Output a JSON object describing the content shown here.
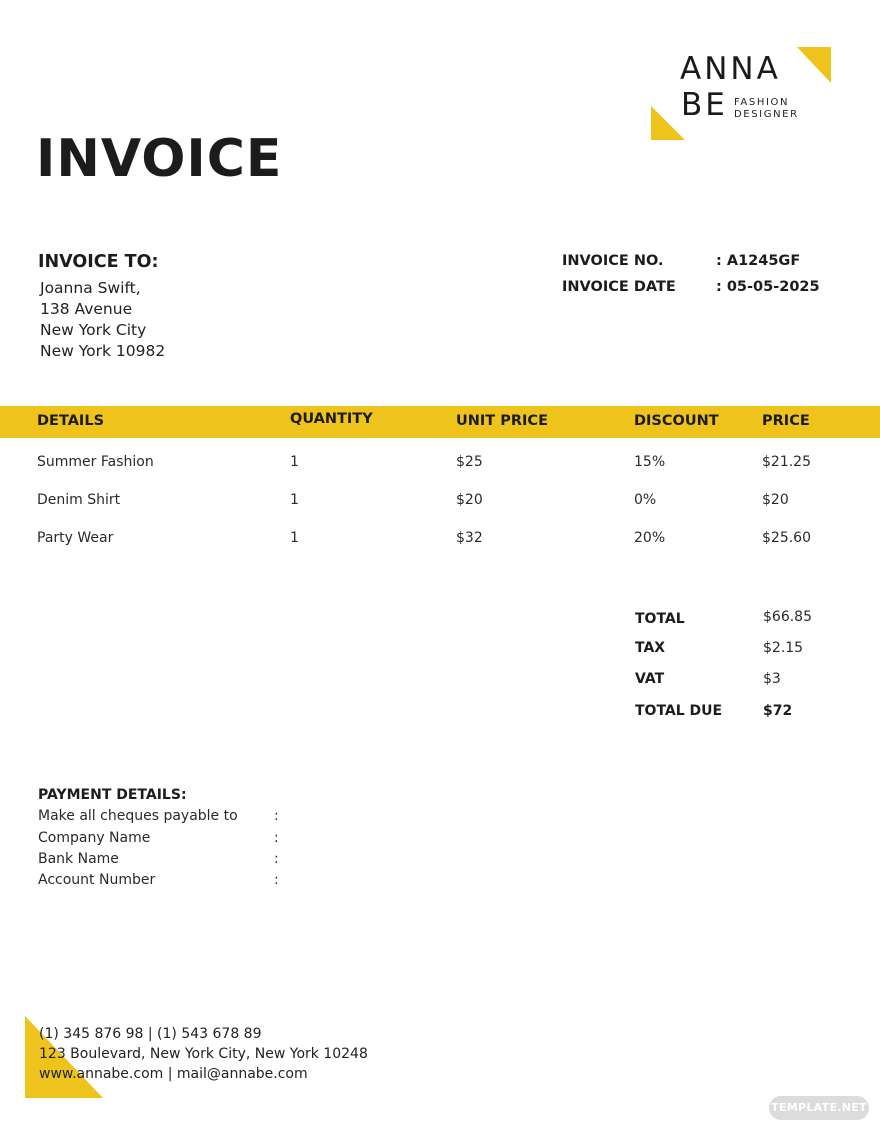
{
  "brand": {
    "name_line1": "ANNA",
    "name_line2": "BE",
    "tagline_line1": "FASHION",
    "tagline_line2": "DESIGNER",
    "accent_color": "#eec31c"
  },
  "document": {
    "title": "INVOICE"
  },
  "invoice_to": {
    "heading": "INVOICE TO:",
    "lines": [
      "Joanna Swift,",
      "138 Avenue",
      "New York City",
      "New York 10982"
    ]
  },
  "invoice_meta": [
    {
      "label": "INVOICE NO.",
      "value": ": A1245GF"
    },
    {
      "label": "INVOICE DATE",
      "value": ": 05-05-2025"
    }
  ],
  "table": {
    "headers": [
      "DETAILS",
      "QUANTITY",
      "UNIT PRICE",
      "DISCOUNT",
      "PRICE"
    ],
    "rows": [
      [
        "Summer Fashion",
        "1",
        "$25",
        "15%",
        "$21.25"
      ],
      [
        "Denim Shirt",
        "1",
        "$20",
        "0%",
        "$20"
      ],
      [
        "Party Wear",
        "1",
        "$32",
        "20%",
        "$25.60"
      ]
    ]
  },
  "summary": [
    {
      "label": "TOTAL",
      "value": "$66.85"
    },
    {
      "label": "TAX",
      "value": "$2.15"
    },
    {
      "label": "VAT",
      "value": "$3"
    },
    {
      "label": "TOTAL DUE",
      "value": "$72"
    }
  ],
  "payment": {
    "heading": "PAYMENT DETAILS:",
    "fields": [
      {
        "label": "Make all cheques payable to",
        "sep": ":"
      },
      {
        "label": "Company Name",
        "sep": ":"
      },
      {
        "label": "Bank Name",
        "sep": ":"
      },
      {
        "label": "Account Number",
        "sep": ":"
      }
    ]
  },
  "footer": {
    "phone": "(1) 345 876 98 | (1) 543 678 89",
    "address": "123 Boulevard, New York City, New York 10248",
    "web": "www.annabe.com | mail@annabe.com"
  },
  "watermark": "TEMPLATE.NET"
}
